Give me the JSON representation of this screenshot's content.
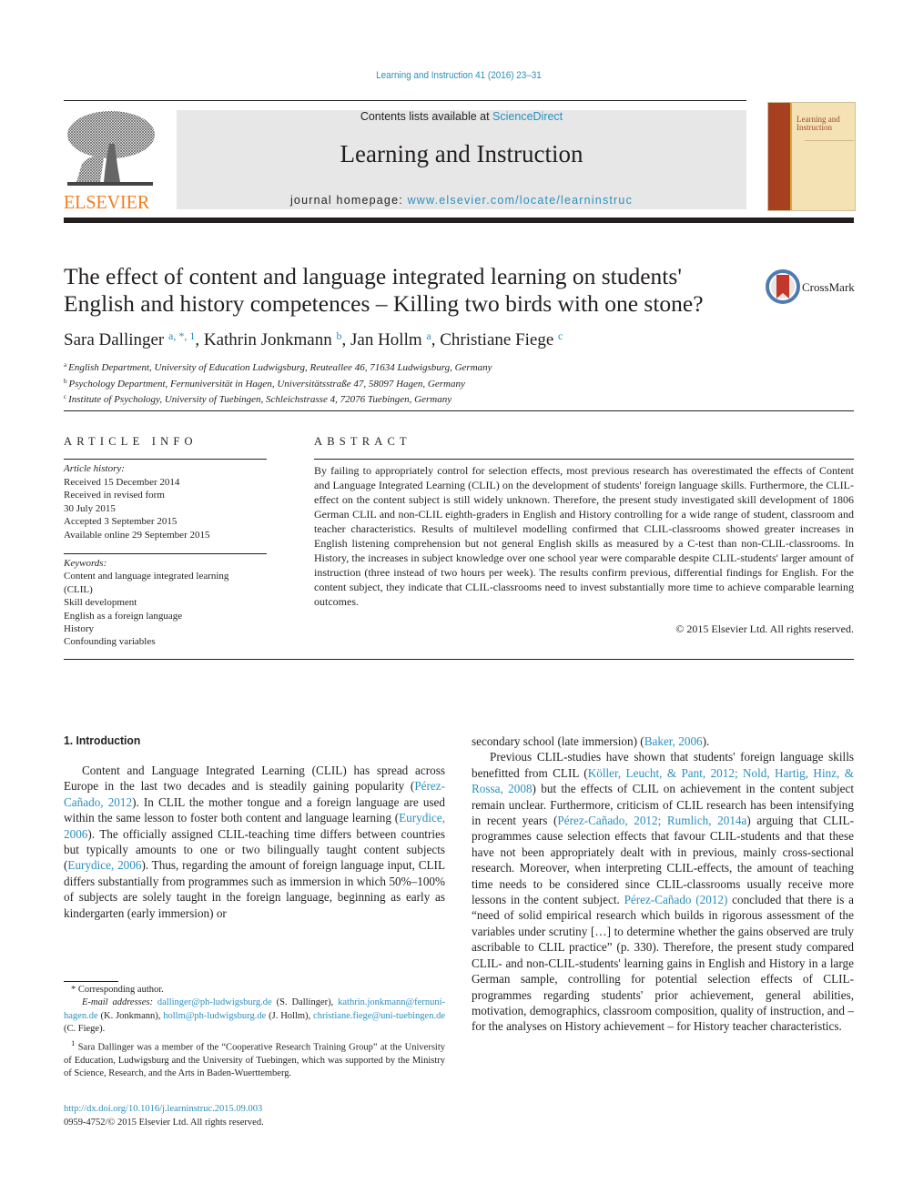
{
  "header": {
    "running_head": "Learning and Instruction 41 (2016) 23–31",
    "publisher_logo_text": "ELSEVIER",
    "contents_prefix": "Contents lists available at ",
    "contents_link": "ScienceDirect",
    "journal_title": "Learning and Instruction",
    "homepage_prefix": "journal homepage: ",
    "homepage_link": "www.elsevier.com/locate/learninstruc",
    "cover_title_line1": "Learning and",
    "cover_title_line2": "Instruction"
  },
  "article": {
    "title_line1": "The effect of content and language integrated learning on students'",
    "title_line2": "English and history competences – Killing two birds with one stone?",
    "crossmark_label": "CrossMark",
    "authors": [
      {
        "name": "Sara Dallinger",
        "marks": "a, *, 1"
      },
      {
        "name": "Kathrin Jonkmann",
        "marks": "b"
      },
      {
        "name": "Jan Hollm",
        "marks": "a"
      },
      {
        "name": "Christiane Fiege",
        "marks": "c"
      }
    ],
    "affiliations": [
      {
        "mark": "a",
        "text": "English Department, University of Education Ludwigsburg, Reuteallee 46, 71634 Ludwigsburg, Germany"
      },
      {
        "mark": "b",
        "text": "Psychology Department, Fernuniversität in Hagen, Universitätsstraße 47, 58097 Hagen, Germany"
      },
      {
        "mark": "c",
        "text": "Institute of Psychology, University of Tuebingen, Schleichstrasse 4, 72076 Tuebingen, Germany"
      }
    ]
  },
  "article_info": {
    "heading": "ARTICLE INFO",
    "history_label": "Article history:",
    "history": [
      "Received 15 December 2014",
      "Received in revised form",
      "30 July 2015",
      "Accepted 3 September 2015",
      "Available online 29 September 2015"
    ],
    "keywords_label": "Keywords:",
    "keywords": [
      "Content and language integrated learning",
      "(CLIL)",
      "Skill development",
      "English as a foreign language",
      "History",
      "Confounding variables"
    ]
  },
  "abstract": {
    "heading": "ABSTRACT",
    "text": "By failing to appropriately control for selection effects, most previous research has overestimated the effects of Content and Language Integrated Learning (CLIL) on the development of students' foreign language skills. Furthermore, the CLIL-effect on the content subject is still widely unknown. Therefore, the present study investigated skill development of 1806 German CLIL and non-CLIL eighth-graders in English and History controlling for a wide range of student, classroom and teacher characteristics. Results of multilevel modelling confirmed that CLIL-classrooms showed greater increases in English listening comprehension but not general English skills as measured by a C-test than non-CLIL-classrooms. In History, the increases in subject knowledge over one school year were comparable despite CLIL-students' larger amount of instruction (three instead of two hours per week). The results confirm previous, differential findings for English. For the content subject, they indicate that CLIL-classrooms need to invest substantially more time to achieve comparable learning outcomes.",
    "copyright": "© 2015 Elsevier Ltd. All rights reserved."
  },
  "body": {
    "section_heading": "1.  Introduction",
    "p1": {
      "t1": "Content and Language Integrated Learning (CLIL) has spread across Europe in the last two decades and is steadily gaining popularity (",
      "c1": "Pérez-Cañado, 2012",
      "t2": "). In CLIL the mother tongue and a foreign language are used within the same lesson to foster both content and language learning (",
      "c2": "Eurydice, 2006",
      "t3": "). The officially assigned CLIL-teaching time differs between countries but typically amounts to one or two bilingually taught content subjects (",
      "c3": "Eurydice, 2006",
      "t4": "). Thus, regarding the amount of foreign language input, CLIL differs substantially from programmes such as immersion in which 50%–100% of subjects are solely taught in the foreign language, beginning as early as kindergarten (early immersion) or secondary school (late immersion) (",
      "c4": "Baker, 2006",
      "t5": ")."
    },
    "p2": {
      "t1": "Previous CLIL-studies have shown that students' foreign language skills benefitted from CLIL (",
      "c1": "Köller, Leucht, & Pant, 2012; Nold, Hartig, Hinz, & Rossa, 2008",
      "t2": ") but the effects of CLIL on achievement in the content subject remain unclear. Furthermore, criticism of CLIL research has been intensifying in recent years (",
      "c2": "Pérez-Cañado, 2012; Rumlich, 2014a",
      "t3": ") arguing that CLIL-programmes cause selection effects that favour CLIL-students and that these have not been appropriately dealt with in previous, mainly cross-sectional research. Moreover, when interpreting CLIL-effects, the amount of teaching time needs to be considered since CLIL-classrooms usually receive more lessons in the content subject. ",
      "c3": "Pérez-Cañado (2012)",
      "t4": " concluded that there is a “need of solid empirical research which builds in rigorous assessment of the variables under scrutiny […] to determine whether the gains observed are truly ascribable to CLIL practice” (p. 330). Therefore, the present study compared CLIL- and non-CLIL-students' learning gains in English and History in a large German sample, controlling for potential selection effects of CLIL-programmes regarding students' prior achievement, general abilities, motivation, demographics, classroom composition, quality of instruction, and – for the analyses on History achievement – for History teacher characteristics."
    }
  },
  "footnotes": {
    "corresponding": "*  Corresponding author.",
    "email_label": "E-mail addresses: ",
    "emails": [
      {
        "addr": "dallinger@ph-ludwigsburg.de",
        "who": " (S. Dallinger), "
      },
      {
        "addr": "kathrin.jonkmann@fernuni-hagen.de",
        "who": " (K. Jonkmann), "
      },
      {
        "addr": "hollm@ph-ludwigsburg.de",
        "who": " (J. Hollm), "
      },
      {
        "addr": "christiane.fiege@uni-tuebingen.de",
        "who": " (C. Fiege)."
      }
    ],
    "note1_mark": "1",
    "note1": " Sara Dallinger was a member of the “Cooperative Research Training Group” at the University of Education, Ludwigsburg and the University of Tuebingen, which was supported by the Ministry of Science, Research, and the Arts in Baden-Wuerttemberg."
  },
  "footer": {
    "doi": "http://dx.doi.org/10.1016/j.learninstruc.2015.09.003",
    "issn": "0959-4752/© 2015 Elsevier Ltd. All rights reserved."
  },
  "colors": {
    "link": "#2a8fbd",
    "elsevier_orange": "#f07f1e",
    "banner_gray": "#e7e7e7",
    "cover_spine": "#a6401f",
    "cover_bg": "#f4e2b4"
  }
}
